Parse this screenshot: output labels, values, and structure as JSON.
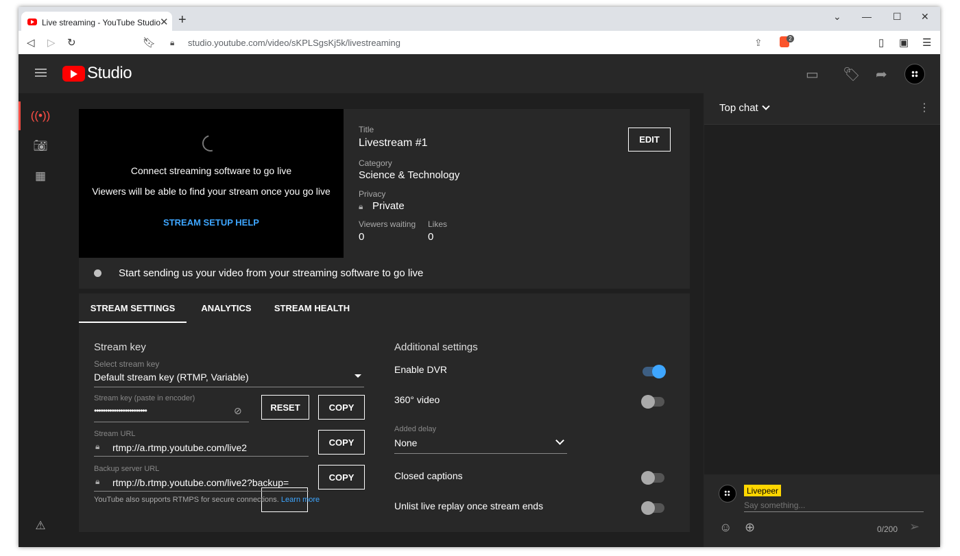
{
  "browser": {
    "tab_title": "Live streaming - YouTube Studio",
    "url": "studio.youtube.com/video/sKPLSgsKj5k/livestreaming",
    "brave_badge": "2"
  },
  "app": {
    "logo_text": "Studio"
  },
  "preview": {
    "line1": "Connect streaming software to go live",
    "line2": "Viewers will be able to find your stream once you go live",
    "help_link": "STREAM SETUP HELP"
  },
  "info": {
    "title_label": "Title",
    "title_value": "Livestream #1",
    "edit_label": "EDIT",
    "category_label": "Category",
    "category_value": "Science & Technology",
    "privacy_label": "Privacy",
    "privacy_value": "Private",
    "viewers_label": "Viewers waiting",
    "viewers_value": "0",
    "likes_label": "Likes",
    "likes_value": "0"
  },
  "status": {
    "text": "Start sending us your video from your streaming software to go live"
  },
  "tabs": [
    {
      "label": "STREAM SETTINGS"
    },
    {
      "label": "ANALYTICS"
    },
    {
      "label": "STREAM HEALTH"
    }
  ],
  "stream_key": {
    "heading": "Stream key",
    "select_label": "Select stream key",
    "select_value": "Default stream key (RTMP, Variable)",
    "key_label": "Stream key (paste in encoder)",
    "key_value": "••••••••••••••••••••••••",
    "reset_label": "RESET",
    "copy_label": "COPY",
    "url_label": "Stream URL",
    "url_value": "rtmp://a.rtmp.youtube.com/live2",
    "backup_label": "Backup server URL",
    "backup_value": "rtmp://b.rtmp.youtube.com/live2?backup=",
    "rtmps_note": "YouTube also supports RTMPS for secure connections.",
    "learn_more": "Learn more"
  },
  "additional": {
    "heading": "Additional settings",
    "dvr_label": "Enable DVR",
    "dvr_on": true,
    "video360_label": "360° video",
    "video360_on": false,
    "delay_label": "Added delay",
    "delay_value": "None",
    "captions_label": "Closed captions",
    "captions_on": false,
    "unlist_label": "Unlist live replay once stream ends",
    "unlist_on": false
  },
  "chat": {
    "header": "Top chat",
    "user_name": "Livepeer",
    "placeholder": "Say something...",
    "counter": "0/200"
  },
  "colors": {
    "accent_blue": "#3ea6ff",
    "youtube_red": "#ff0000",
    "active_nav": "#ff4e45",
    "chip_yellow": "#ffd600"
  }
}
